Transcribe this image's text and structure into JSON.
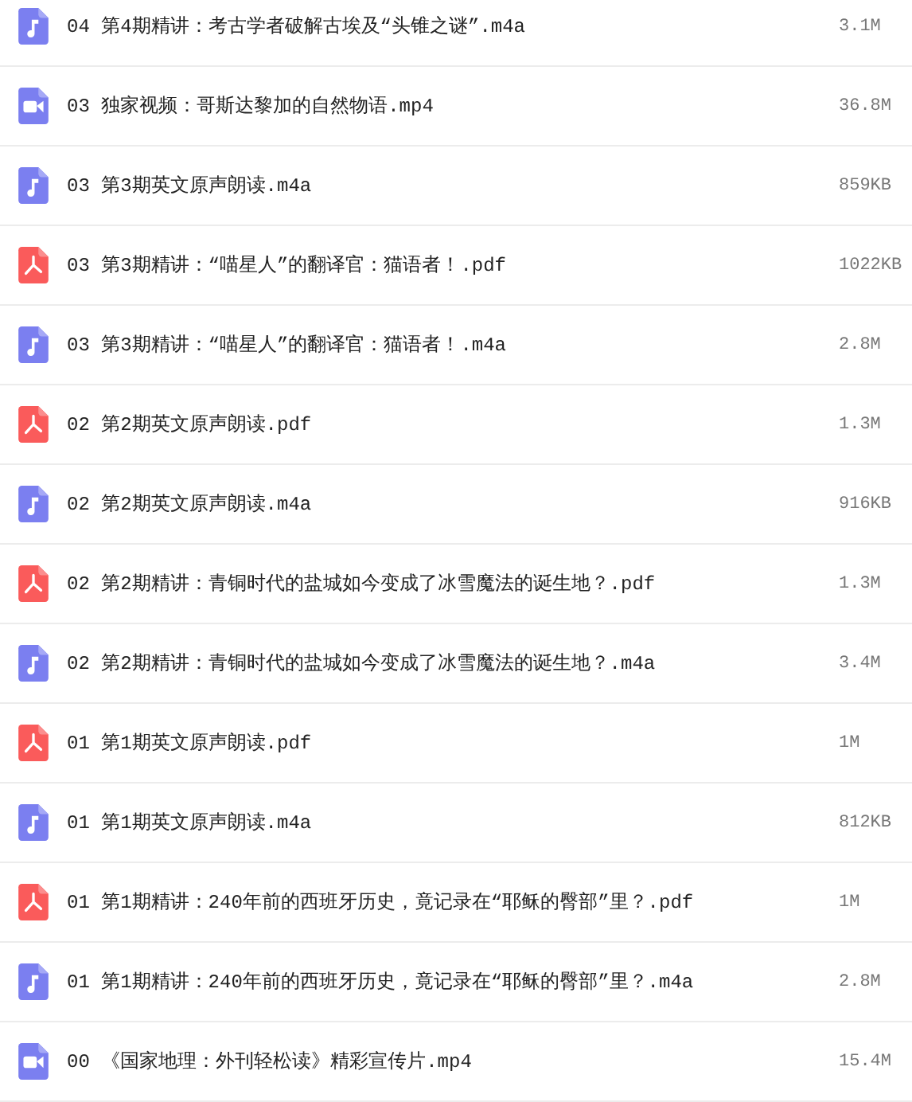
{
  "files": [
    {
      "kind": "audio",
      "name": "04 第4期精讲：考古学者破解古埃及“头锥之谜”.m4a",
      "size": "3.1M"
    },
    {
      "kind": "video",
      "name": "03 独家视频：哥斯达黎加的自然物语.mp4",
      "size": "36.8M"
    },
    {
      "kind": "audio",
      "name": "03 第3期英文原声朗读.m4a",
      "size": "859KB"
    },
    {
      "kind": "pdf",
      "name": "03 第3期精讲：“喵星人”的翻译官：猫语者！.pdf",
      "size": "1022KB"
    },
    {
      "kind": "audio",
      "name": "03 第3期精讲：“喵星人”的翻译官：猫语者！.m4a",
      "size": "2.8M"
    },
    {
      "kind": "pdf",
      "name": "02 第2期英文原声朗读.pdf",
      "size": "1.3M"
    },
    {
      "kind": "audio",
      "name": "02 第2期英文原声朗读.m4a",
      "size": "916KB"
    },
    {
      "kind": "pdf",
      "name": "02 第2期精讲：青铜时代的盐城如今变成了冰雪魔法的诞生地？.pdf",
      "size": "1.3M"
    },
    {
      "kind": "audio",
      "name": "02 第2期精讲：青铜时代的盐城如今变成了冰雪魔法的诞生地？.m4a",
      "size": "3.4M"
    },
    {
      "kind": "pdf",
      "name": "01 第1期英文原声朗读.pdf",
      "size": "1M"
    },
    {
      "kind": "audio",
      "name": "01 第1期英文原声朗读.m4a",
      "size": "812KB"
    },
    {
      "kind": "pdf",
      "name": "01 第1期精讲：240年前的西班牙历史，竟记录在“耶稣的臀部”里？.pdf",
      "size": "1M"
    },
    {
      "kind": "audio",
      "name": "01 第1期精讲：240年前的西班牙历史，竟记录在“耶稣的臀部”里？.m4a",
      "size": "2.8M"
    },
    {
      "kind": "video",
      "name": "00 《国家地理：外刊轻松读》精彩宣传片.mp4",
      "size": "15.4M"
    }
  ]
}
